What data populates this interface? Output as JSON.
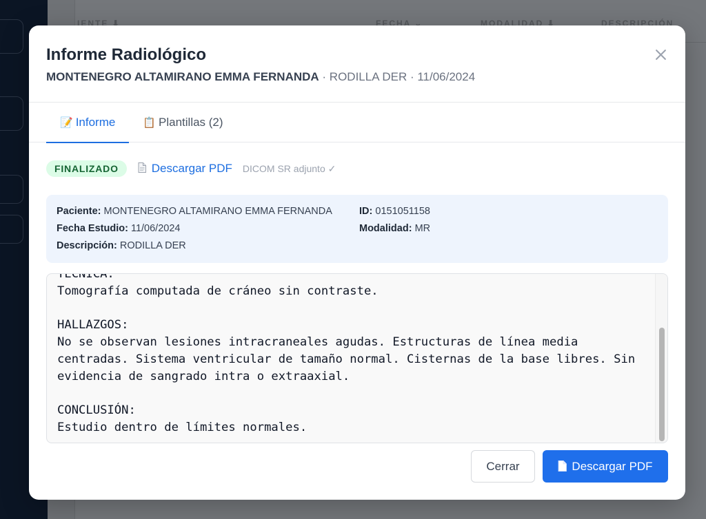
{
  "background": {
    "columns": [
      "IENTE ⬇",
      "FECHA ⌄",
      "MODALIDAD ⬇",
      "DESCRIPCIÓN"
    ]
  },
  "modal": {
    "title": "Informe Radiológico",
    "subtitle": {
      "patient": "MONTENEGRO ALTAMIRANO EMMA FERNANDA",
      "rest": " · RODILLA DER · 11/06/2024"
    },
    "close_icon": "close-icon",
    "tabs": [
      {
        "emoji": "📝",
        "label": "Informe",
        "active": true
      },
      {
        "emoji": "📋",
        "label": "Plantillas (2)",
        "active": false
      }
    ],
    "status_badge": "FINALIZADO",
    "pdf_link": "Descargar PDF",
    "dicom_note": "DICOM SR adjunto ✓",
    "info": {
      "patient_label": "Paciente:",
      "patient_value": "MONTENEGRO ALTAMIRANO EMMA FERNANDA",
      "id_label": "ID:",
      "id_value": "0151051158",
      "date_label": "Fecha Estudio:",
      "date_value": "11/06/2024",
      "modality_label": "Modalidad:",
      "modality_value": "MR",
      "desc_label": "Descripción:",
      "desc_value": "RODILLA DER"
    },
    "report_text": "TÉCNICA:\nTomografía computada de cráneo sin contraste.\n\nHALLAZGOS:\nNo se observan lesiones intracraneales agudas. Estructuras de línea media centradas. Sistema ventricular de tamaño normal. Cisternas de la base libres. Sin evidencia de sangrado intra o extraaxial.\n\nCONCLUSIÓN:\nEstudio dentro de límites normales.",
    "buttons": {
      "close": "Cerrar",
      "download": "Descargar PDF"
    },
    "colors": {
      "accent": "#1f6feb",
      "badge_bg": "#dcfce7",
      "badge_text": "#166534",
      "info_bg": "#eef4fd"
    }
  }
}
